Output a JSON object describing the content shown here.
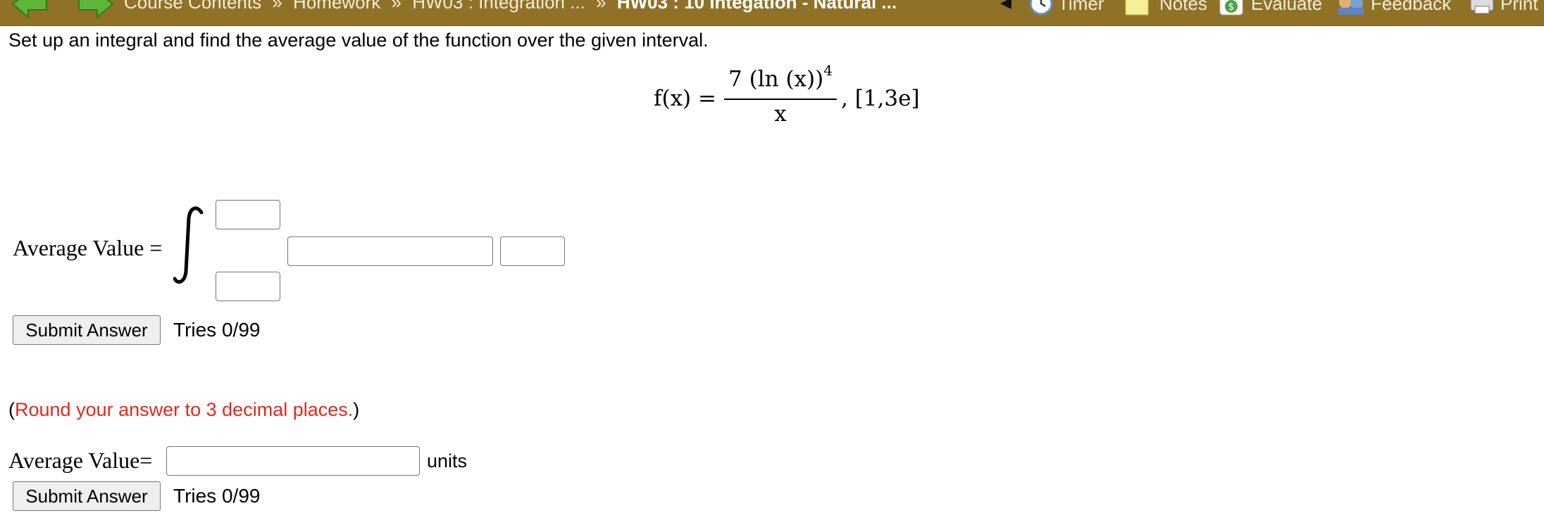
{
  "nav": {
    "breadcrumb": [
      {
        "label": "Course Contents"
      },
      {
        "label": "Homework"
      },
      {
        "label": "HW03 : Integration ..."
      },
      {
        "label": "HW03 : 10 Integation - Natural ..."
      }
    ],
    "separator": "»",
    "tools": {
      "timer": "Timer",
      "notes": "Notes",
      "evaluate": "Evaluate",
      "feedback": "Feedback",
      "print": "Print"
    }
  },
  "question": {
    "prompt": "Set up an integral and find the average value of the function over the given interval.",
    "formula": {
      "lhs": "f(x) =",
      "numerator_base": "7 (ln (x))",
      "numerator_exp": "4",
      "denominator": "x",
      "interval": ", [1,3e]"
    }
  },
  "part1": {
    "label": "Average Value =",
    "upper_limit": "",
    "lower_limit": "",
    "integrand": "",
    "differential": "",
    "submit_label": "Submit Answer",
    "tries": "Tries 0/99"
  },
  "part2": {
    "note_open": "(",
    "note_text": "Round your answer to 3 decimal places.",
    "note_close": ")",
    "label": "Average Value=",
    "answer": "",
    "units": "units",
    "submit_label": "Submit Answer",
    "tries": "Tries 0/99"
  },
  "colors": {
    "topbar": "#8f7227",
    "note_red": "#e0291d"
  }
}
